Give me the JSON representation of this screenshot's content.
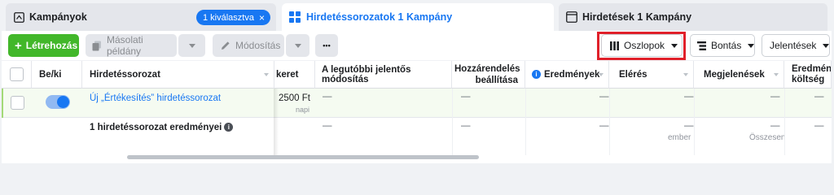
{
  "tabs": {
    "campaigns": {
      "label": "Kampányok",
      "selected_pill": "1 kiválasztva",
      "pill_close": "×"
    },
    "adsets": {
      "label": "Hirdetéssorozatok 1 Kampány"
    },
    "ads": {
      "label": "Hirdetések 1 Kampány"
    }
  },
  "toolbar": {
    "create_label": "Létrehozás",
    "duplicate_label": "Másolati példány",
    "edit_label": "Módosítás",
    "more_label": "•••",
    "columns_label": "Oszlopok",
    "breakdown_label": "Bontás",
    "reports_label": "Jelentések"
  },
  "table": {
    "headers": {
      "onoff": "Be/ki",
      "adset": "Hirdetéssorozat",
      "budget": "keret",
      "last_edit": "A legutóbbi jelentős módosítás",
      "attribution": "Hozzárendelés beállítása",
      "results": "Eredmények",
      "reach": "Elérés",
      "impressions": "Megjelenések",
      "cost": "Eredmények költség"
    },
    "row": {
      "name": "Új „Értékesítés” hirdetéssorozat",
      "budget_value": "2500 Ft",
      "budget_period": "napi",
      "last_edit": "—",
      "attribution": "—",
      "results": "—",
      "reach": "—",
      "impressions": "—",
      "cost": "—"
    },
    "summary": {
      "label": "1 hirdetéssorozat eredményei",
      "last_edit": "—",
      "attribution": "—",
      "results": "—",
      "reach": "—",
      "reach_sub": "ember",
      "impressions": "—",
      "impressions_sub": "Összesen",
      "cost": "—"
    }
  },
  "colors": {
    "accent": "#1877f2",
    "create_green": "#42b72a",
    "highlight_red": "#e0202a",
    "selected_row": "#f5fbf1"
  },
  "icons": [
    "campaign-folder-icon",
    "adsets-grid-icon",
    "ads-page-icon",
    "copy-icon",
    "pencil-icon",
    "columns-icon",
    "breakdown-icon",
    "info-icon",
    "close-icon",
    "caret-down-icon"
  ]
}
